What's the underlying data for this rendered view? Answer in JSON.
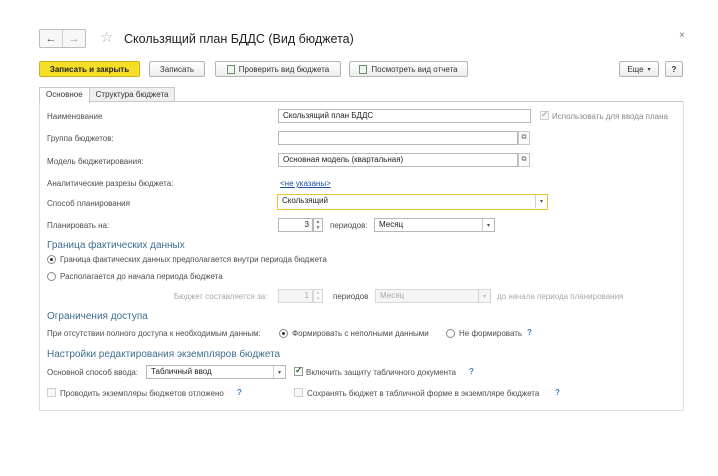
{
  "window": {
    "title": "Скользящий план БДДС (Вид бюджета)",
    "close_glyph": "×"
  },
  "nav": {
    "back": "←",
    "forward": "→",
    "favorite": "☆"
  },
  "toolbar": {
    "save_close": "Записать и закрыть",
    "save": "Записать",
    "check": "Проверить вид бюджета",
    "report": "Посмотреть вид отчета",
    "more": "Еще",
    "more_arrow": "▾",
    "help": "?"
  },
  "tabs": [
    "Основное",
    "Структура бюджета"
  ],
  "form": {
    "name": {
      "label": "Наименование",
      "value": "Скользящий план БДДС"
    },
    "use_for_input": {
      "label": "Использовать для ввода плана",
      "checked": true
    },
    "group": {
      "label": "Группа бюджетов:",
      "value": ""
    },
    "model": {
      "label": "Модель бюджетирования:",
      "value": "Основная модель (квартальная)"
    },
    "analytics": {
      "label": "Аналитические разрезы бюджета:",
      "link": "<не указаны>"
    },
    "planning_method": {
      "label": "Способ планирования",
      "value": "Скользящий"
    },
    "plan_for": {
      "label": "Планировать на:",
      "value": "3",
      "periods_label": "периодов:",
      "period": "Месяц"
    }
  },
  "actual_border": {
    "title": "Граница фактических данных",
    "option1": "Граница фактических данных предполагается внутри периода бюджета",
    "option2": "Располагается до начала периода бюджета",
    "composed_label": "Бюджет составляется за:",
    "composed_value": "1",
    "periods_label": "периодов",
    "period": "Месяц",
    "suffix": "до начала периода планирования"
  },
  "access": {
    "title": "Ограничения доступа",
    "label": "При отсутствии полного доступа к необходимым данным:",
    "option1": "Формировать с неполными данными",
    "option2": "Не формировать",
    "help": "?"
  },
  "edit_settings": {
    "title": "Настройки редактирования экземпляров бюджета",
    "input_label": "Основной способ ввода:",
    "input_value": "Табличный ввод",
    "protect_label": "Включить защиту табличного документа",
    "protect_checked": true,
    "deferred_label": "Проводить экземпляры бюджетов отложено",
    "deferred_checked": false,
    "save_table_label": "Сохранять бюджет в табличной форме в экземпляре бюджета",
    "save_table_checked": false,
    "help": "?"
  },
  "colors": {
    "accent": "#f7df27",
    "section": "#3f6f8f",
    "link": "#1b4fa0",
    "active_border": "#e8c52b"
  }
}
